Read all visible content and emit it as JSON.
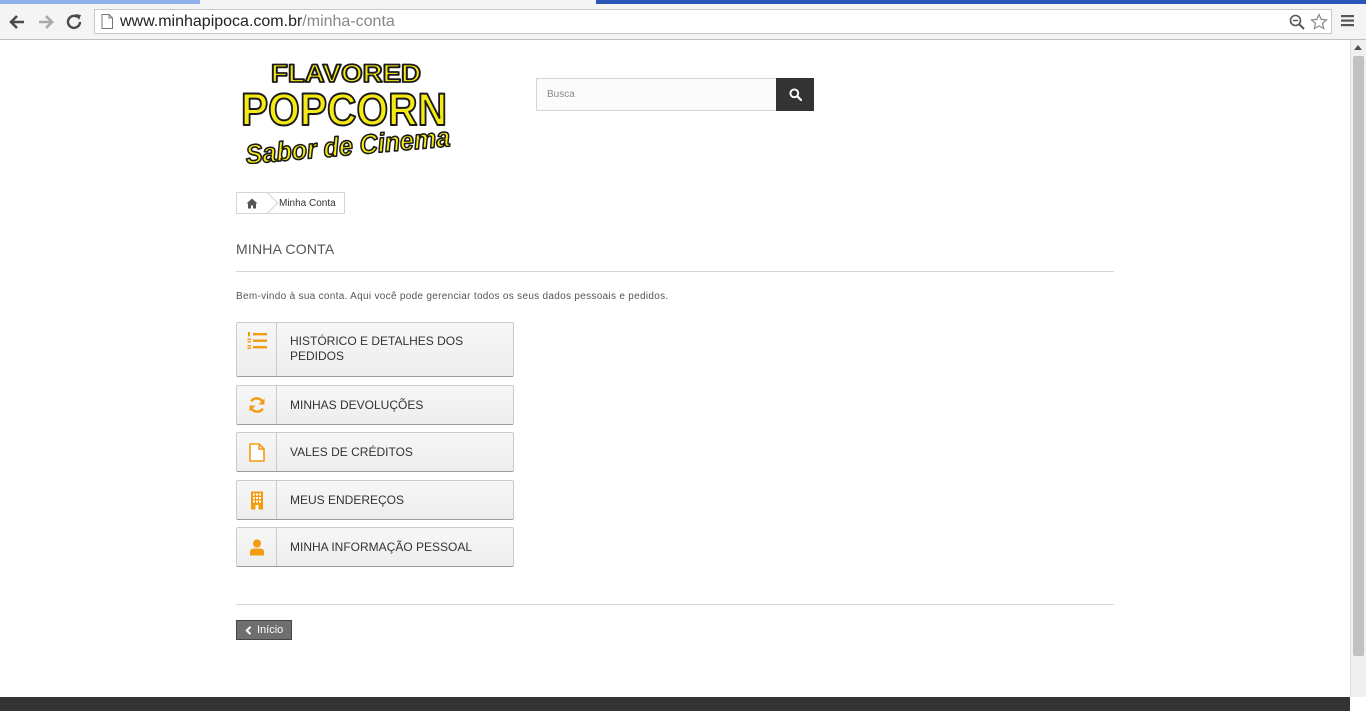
{
  "browser": {
    "url_host": "www.minhapipoca.com.br",
    "url_path": "/minha-conta"
  },
  "header": {
    "logo": {
      "line1": "FLAVORED",
      "line2": "POPCORN",
      "line3": "Sabor de Cinema"
    },
    "search": {
      "placeholder": "Busca"
    }
  },
  "breadcrumb": {
    "current": "Minha Conta"
  },
  "page": {
    "title": "MINHA CONTA",
    "welcome": "Bem-vindo à sua conta. Aqui você pode gerenciar todos os seus dados pessoais e pedidos.",
    "accent_color": "#f39c12",
    "links": [
      {
        "label": "HISTÓRICO E DETALHES DOS PEDIDOS",
        "icon": "list-ol-icon"
      },
      {
        "label": "MINHAS DEVOLUÇÕES",
        "icon": "refresh-icon"
      },
      {
        "label": "VALES DE CRÉDITOS",
        "icon": "file-icon"
      },
      {
        "label": "MEUS ENDEREÇOS",
        "icon": "building-icon"
      },
      {
        "label": "MINHA INFORMAÇÃO PESSOAL",
        "icon": "user-icon"
      }
    ],
    "home_button": "Início"
  }
}
